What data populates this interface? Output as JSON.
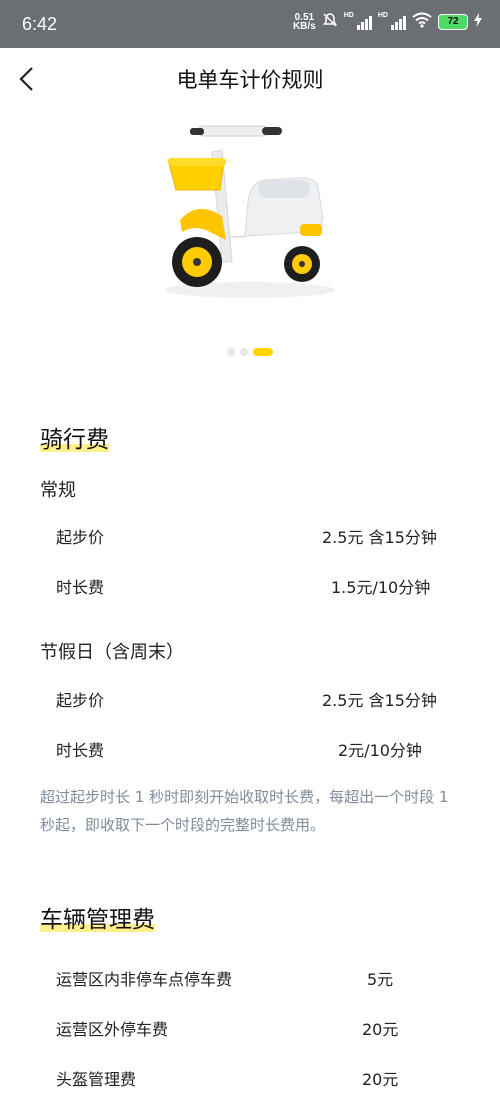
{
  "status_bar": {
    "time": "6:42",
    "speed_value": "0.51",
    "speed_unit": "KB/s",
    "hd1": "HD",
    "hd2": "HD",
    "battery": "72"
  },
  "header": {
    "title": "电单车计价规则"
  },
  "carousel": {
    "pages": 3,
    "active_index": 2,
    "accent": "#ffd400"
  },
  "riding_fee": {
    "title": "骑行费",
    "regular": {
      "label": "常规",
      "items": [
        {
          "label": "起步价",
          "value": "2.5元 含15分钟"
        },
        {
          "label": "时长费",
          "value": "1.5元/10分钟"
        }
      ]
    },
    "holiday": {
      "label": "节假日（含周末）",
      "items": [
        {
          "label": "起步价",
          "value": "2.5元 含15分钟"
        },
        {
          "label": "时长费",
          "value": "2元/10分钟"
        }
      ]
    },
    "note": "超过起步时长 1 秒时即刻开始收取时长费，每超出一个时段 1 秒起，即收取下一个时段的完整时长费用。"
  },
  "management_fee": {
    "title": "车辆管理费",
    "items": [
      {
        "label": "运营区内非停车点停车费",
        "value": "5元"
      },
      {
        "label": "运营区外停车费",
        "value": "20元"
      },
      {
        "label": "头盔管理费",
        "value": "20元"
      }
    ]
  }
}
